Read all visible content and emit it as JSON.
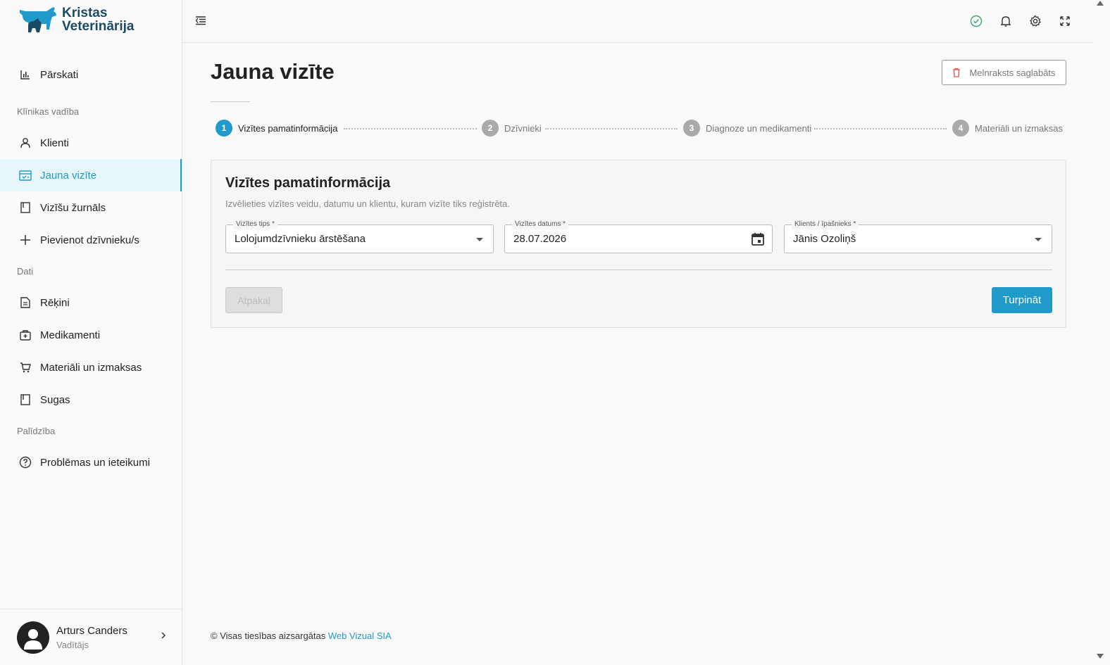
{
  "brand": {
    "line1": "Kristas",
    "line2": "Veterinārija",
    "color": "#1b4a63"
  },
  "accent": "#1f9ac9",
  "sidebar": {
    "top_item": {
      "label": "Pārskati",
      "icon": "bar-chart-icon"
    },
    "sections": [
      {
        "title": "Klīnikas vadība",
        "items": [
          {
            "label": "Klienti",
            "icon": "user-icon"
          },
          {
            "label": "Jauna vizīte",
            "icon": "calendar-check-icon",
            "active": true
          },
          {
            "label": "Vizīšu žurnāls",
            "icon": "book-icon"
          },
          {
            "label": "Pievienot dzīvnieku/s",
            "icon": "plus-icon"
          }
        ]
      },
      {
        "title": "Dati",
        "items": [
          {
            "label": "Rēķini",
            "icon": "invoice-icon"
          },
          {
            "label": "Medikamenti",
            "icon": "medical-kit-icon"
          },
          {
            "label": "Materiāli un izmaksas",
            "icon": "cart-icon"
          },
          {
            "label": "Sugas",
            "icon": "book-icon"
          }
        ]
      },
      {
        "title": "Palīdzība",
        "items": [
          {
            "label": "Problēmas un ieteikumi",
            "icon": "help-circle-icon"
          }
        ]
      }
    ],
    "user": {
      "name": "Arturs Canders",
      "role": "Vadītājs"
    }
  },
  "topbar": {
    "icons": [
      "check-circle-icon",
      "bell-icon",
      "gear-icon",
      "fullscreen-icon"
    ]
  },
  "page": {
    "title": "Jauna vizīte",
    "draft_button": "Melnraksts saglabāts"
  },
  "stepper": [
    {
      "num": "1",
      "label": "Vizītes pamatinformācija",
      "active": true
    },
    {
      "num": "2",
      "label": "Dzīvnieki"
    },
    {
      "num": "3",
      "label": "Diagnoze un medikamenti"
    },
    {
      "num": "4",
      "label": "Materiāli un izmaksas"
    }
  ],
  "card": {
    "title": "Vizītes pamatinformācija",
    "subtitle": "Izvēlieties vizītes veidu, datumu un klientu, kuram vizīte tiks reģistrēta.",
    "fields": {
      "visit_type": {
        "label": "Vizītes tips *",
        "value": "Lolojumdzīvnieku ārstēšana"
      },
      "visit_date": {
        "label": "Vizītes datums *",
        "value": "28.07.2026"
      },
      "client": {
        "label": "Klients / īpašnieks *",
        "value": "Jānis Ozoliņš"
      }
    },
    "back_button": "Atpakaļ",
    "next_button": "Turpināt"
  },
  "footer": {
    "text": "© Visas tiesības aizsargātas",
    "link": "Web Vizual SIA"
  }
}
